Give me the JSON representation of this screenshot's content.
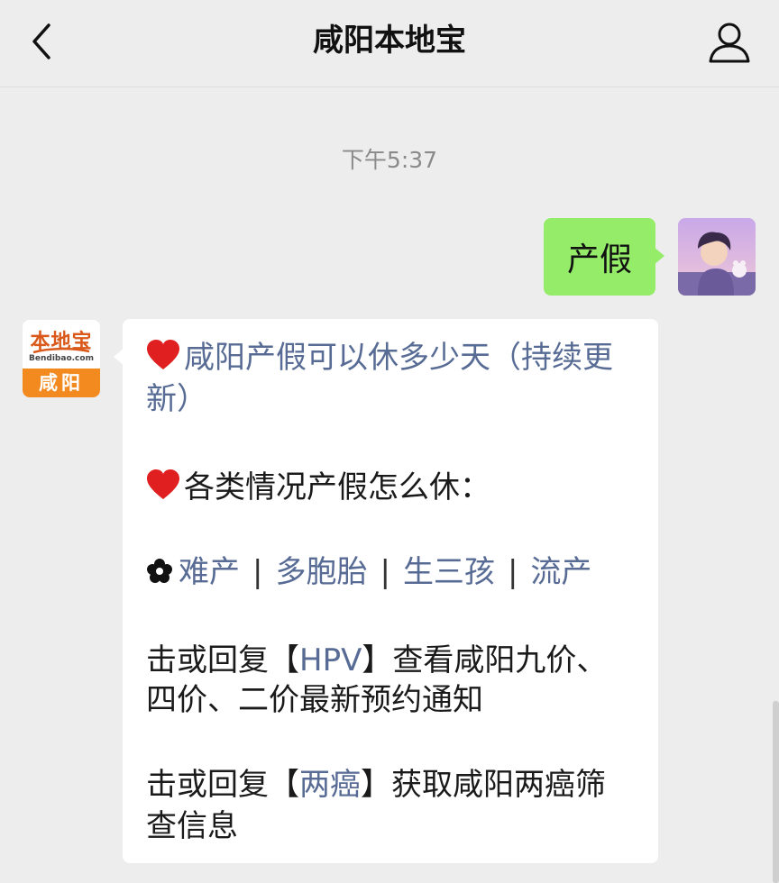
{
  "header": {
    "title": "咸阳本地宝"
  },
  "chat": {
    "timestamp": "下午5:37",
    "sent_message": "产假",
    "bot_avatar": {
      "logo_text": "本地宝",
      "logo_sub": "Bendibao.com",
      "city": "咸阳"
    },
    "received": {
      "line1": "咸阳产假可以休多少天（持续更",
      "line1b": "新）",
      "line2": "各类情况产假怎么休：",
      "links": [
        "难产",
        "多胞胎",
        "生三孩",
        "流产"
      ],
      "separator": "|",
      "hpv_prefix": "击或回复【",
      "hpv_link": "HPV",
      "hpv_suffix": "】查看咸阳九价、",
      "hpv_line2": "四价、二价最新预约通知",
      "cancer_prefix": "击或回复【",
      "cancer_link": "两癌",
      "cancer_suffix": "】获取咸阳两癌筛",
      "cancer_line2": "查信息"
    }
  },
  "colors": {
    "sent_bubble": "#95ec69",
    "link": "#576b95",
    "background": "#ededed",
    "heart": "#e02020"
  },
  "icons": {
    "back": "chevron-left-icon",
    "profile": "person-icon",
    "heart": "heart-icon",
    "flower": "flower-icon"
  }
}
